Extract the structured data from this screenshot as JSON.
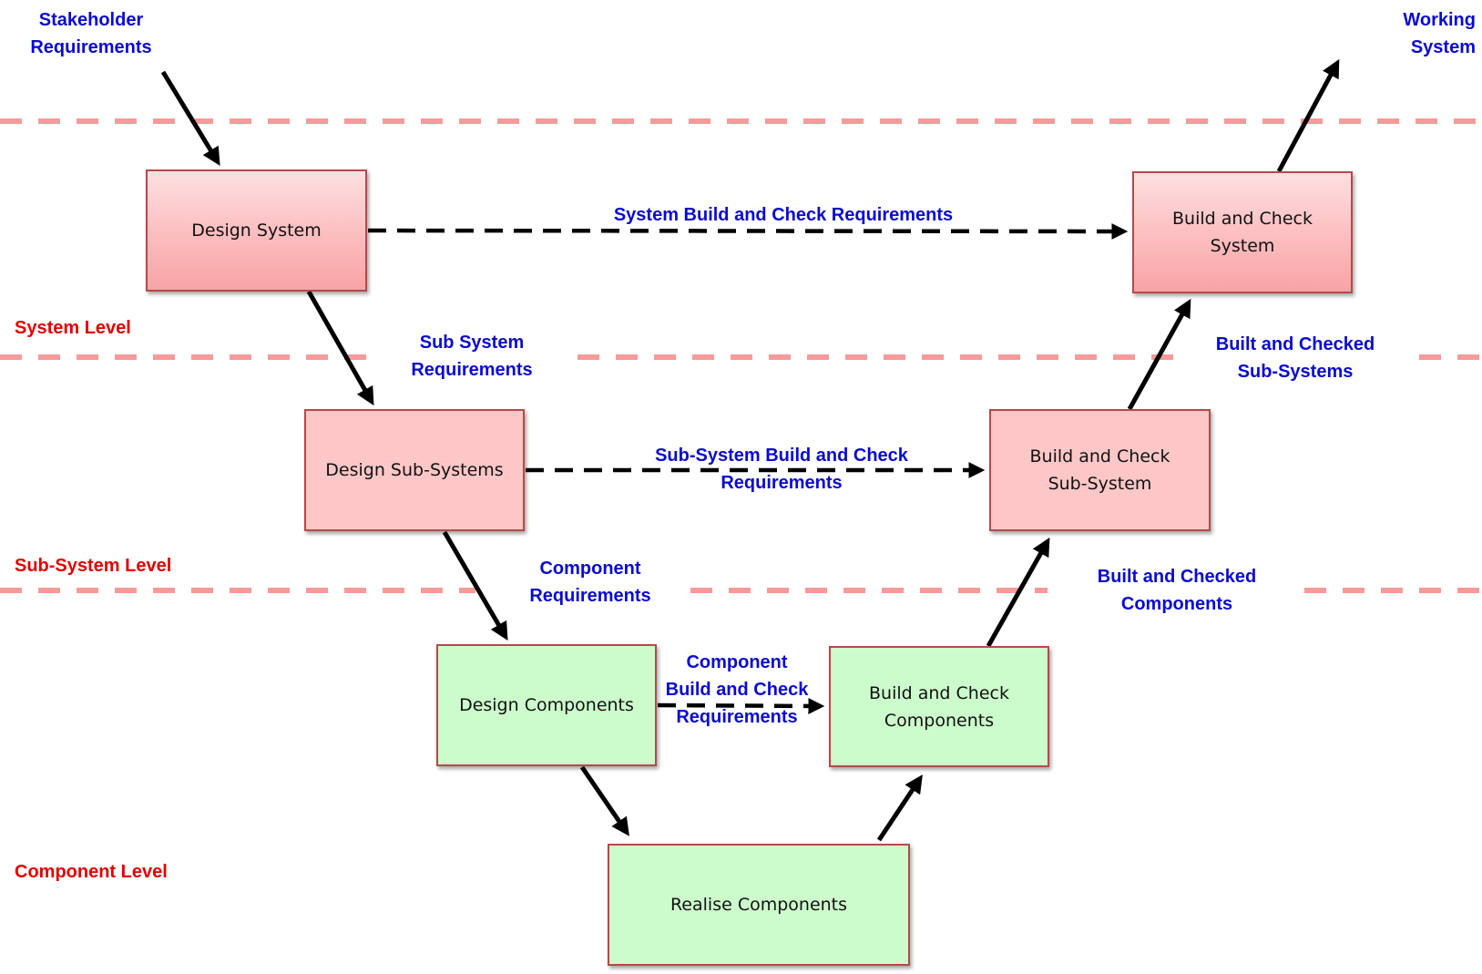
{
  "colors": {
    "level_line": "#f69a9a",
    "arrow": "#000000",
    "label_blue": "#0a0ad0",
    "level_red": "#e00000",
    "design_box_fill": "#fcc0c2",
    "component_box_fill": "#ccfccc",
    "box_border": "#b5494a"
  },
  "levels": [
    {
      "label": "System Level"
    },
    {
      "label": "Sub-System Level"
    },
    {
      "label": "Component  Level"
    }
  ],
  "boxes": {
    "design_system": "Design System",
    "build_check_system": "Build and Check\nSystem",
    "design_subsystems": "Design Sub-Systems",
    "build_check_subsystem": "Build and Check\nSub-System",
    "design_components": "Design Components",
    "build_check_components": "Build and Check\nComponents",
    "realise_components": "Realise Components"
  },
  "flow_labels": {
    "stakeholder_requirements": "Stakeholder\nRequirements",
    "working_system": "Working\nSystem",
    "system_build_check_requirements": "System Build and Check Requirements",
    "subsystem_requirements": "Sub System\nRequirements",
    "subsystem_build_check_requirements": "Sub-System Build and Check\nRequirements",
    "built_checked_subsystems": "Built and Checked\nSub-Systems",
    "component_requirements": "Component\nRequirements",
    "built_checked_components": "Built and Checked\nComponents",
    "component_build_check_requirements": "Component\nBuild and Check\nRequirements"
  }
}
